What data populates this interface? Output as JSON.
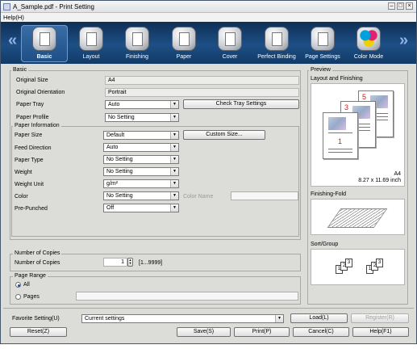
{
  "window": {
    "title": "A_Sample.pdf - Print Setting"
  },
  "menu": {
    "help": "Help(H)"
  },
  "toolbar": {
    "tabs": [
      {
        "label": "Basic"
      },
      {
        "label": "Layout"
      },
      {
        "label": "Finishing"
      },
      {
        "label": "Paper"
      },
      {
        "label": "Cover"
      },
      {
        "label": "Perfect Binding"
      },
      {
        "label": "Page Settings"
      },
      {
        "label": "Color Mode"
      }
    ],
    "prev_arrow": "«",
    "next_arrow": "»",
    "active_index": 0
  },
  "basic": {
    "title": "Basic",
    "original_size_label": "Original Size",
    "original_size_value": "A4",
    "original_orientation_label": "Original Orientation",
    "original_orientation_value": "Portrait",
    "paper_tray_label": "Paper Tray",
    "paper_tray_value": "Auto",
    "check_tray_button": "Check Tray Settings",
    "paper_profile_label": "Paper Profile",
    "paper_profile_value": "No Setting"
  },
  "paper_info": {
    "title": "Paper Information",
    "paper_size_label": "Paper Size",
    "paper_size_value": "Default",
    "custom_size_button": "Custom Size...",
    "feed_direction_label": "Feed Direction",
    "feed_direction_value": "Auto",
    "paper_type_label": "Paper Type",
    "paper_type_value": "No Setting",
    "weight_label": "Weight",
    "weight_value": "No Setting",
    "weight_unit_label": "Weight Unit",
    "weight_unit_value": "g/m²",
    "color_label": "Color",
    "color_value": "No Setting",
    "color_name_label": "Color Name",
    "color_name_value": "",
    "pre_punched_label": "Pre-Punched",
    "pre_punched_value": "Off"
  },
  "copies": {
    "title": "Number of Copies",
    "label": "Number of Copies",
    "value": "1",
    "range": "[1...9999]"
  },
  "page_range": {
    "title": "Page Range",
    "all_label": "All",
    "pages_label": "Pages",
    "pages_value": "",
    "selected": "All"
  },
  "preview": {
    "title": "Preview",
    "layout_finishing_label": "Layout and Finishing",
    "paper_size": "A4",
    "paper_dims": "8.27 x 11.69 inch",
    "page_numbers": [
      "5",
      "3",
      "1"
    ],
    "fold_label": "Finishing-Fold",
    "sort_label": "Sort/Group",
    "sort_numbers": [
      "1",
      "2",
      "3",
      "1",
      "2",
      "3"
    ]
  },
  "favorite": {
    "label": "Favorite Setting(U)",
    "value": "Current settings",
    "load_button": "Load(L)",
    "register_button": "Register(R)"
  },
  "footer": {
    "reset_button": "Reset(Z)",
    "save_button": "Save(S)",
    "print_button": "Print(P)",
    "cancel_button": "Cancel(C)",
    "help_button": "Help(F1)"
  },
  "colors": {
    "toolbar": "#1d4f86",
    "dialog_bg": "#dcdcd8",
    "page_number": "#c02020"
  }
}
